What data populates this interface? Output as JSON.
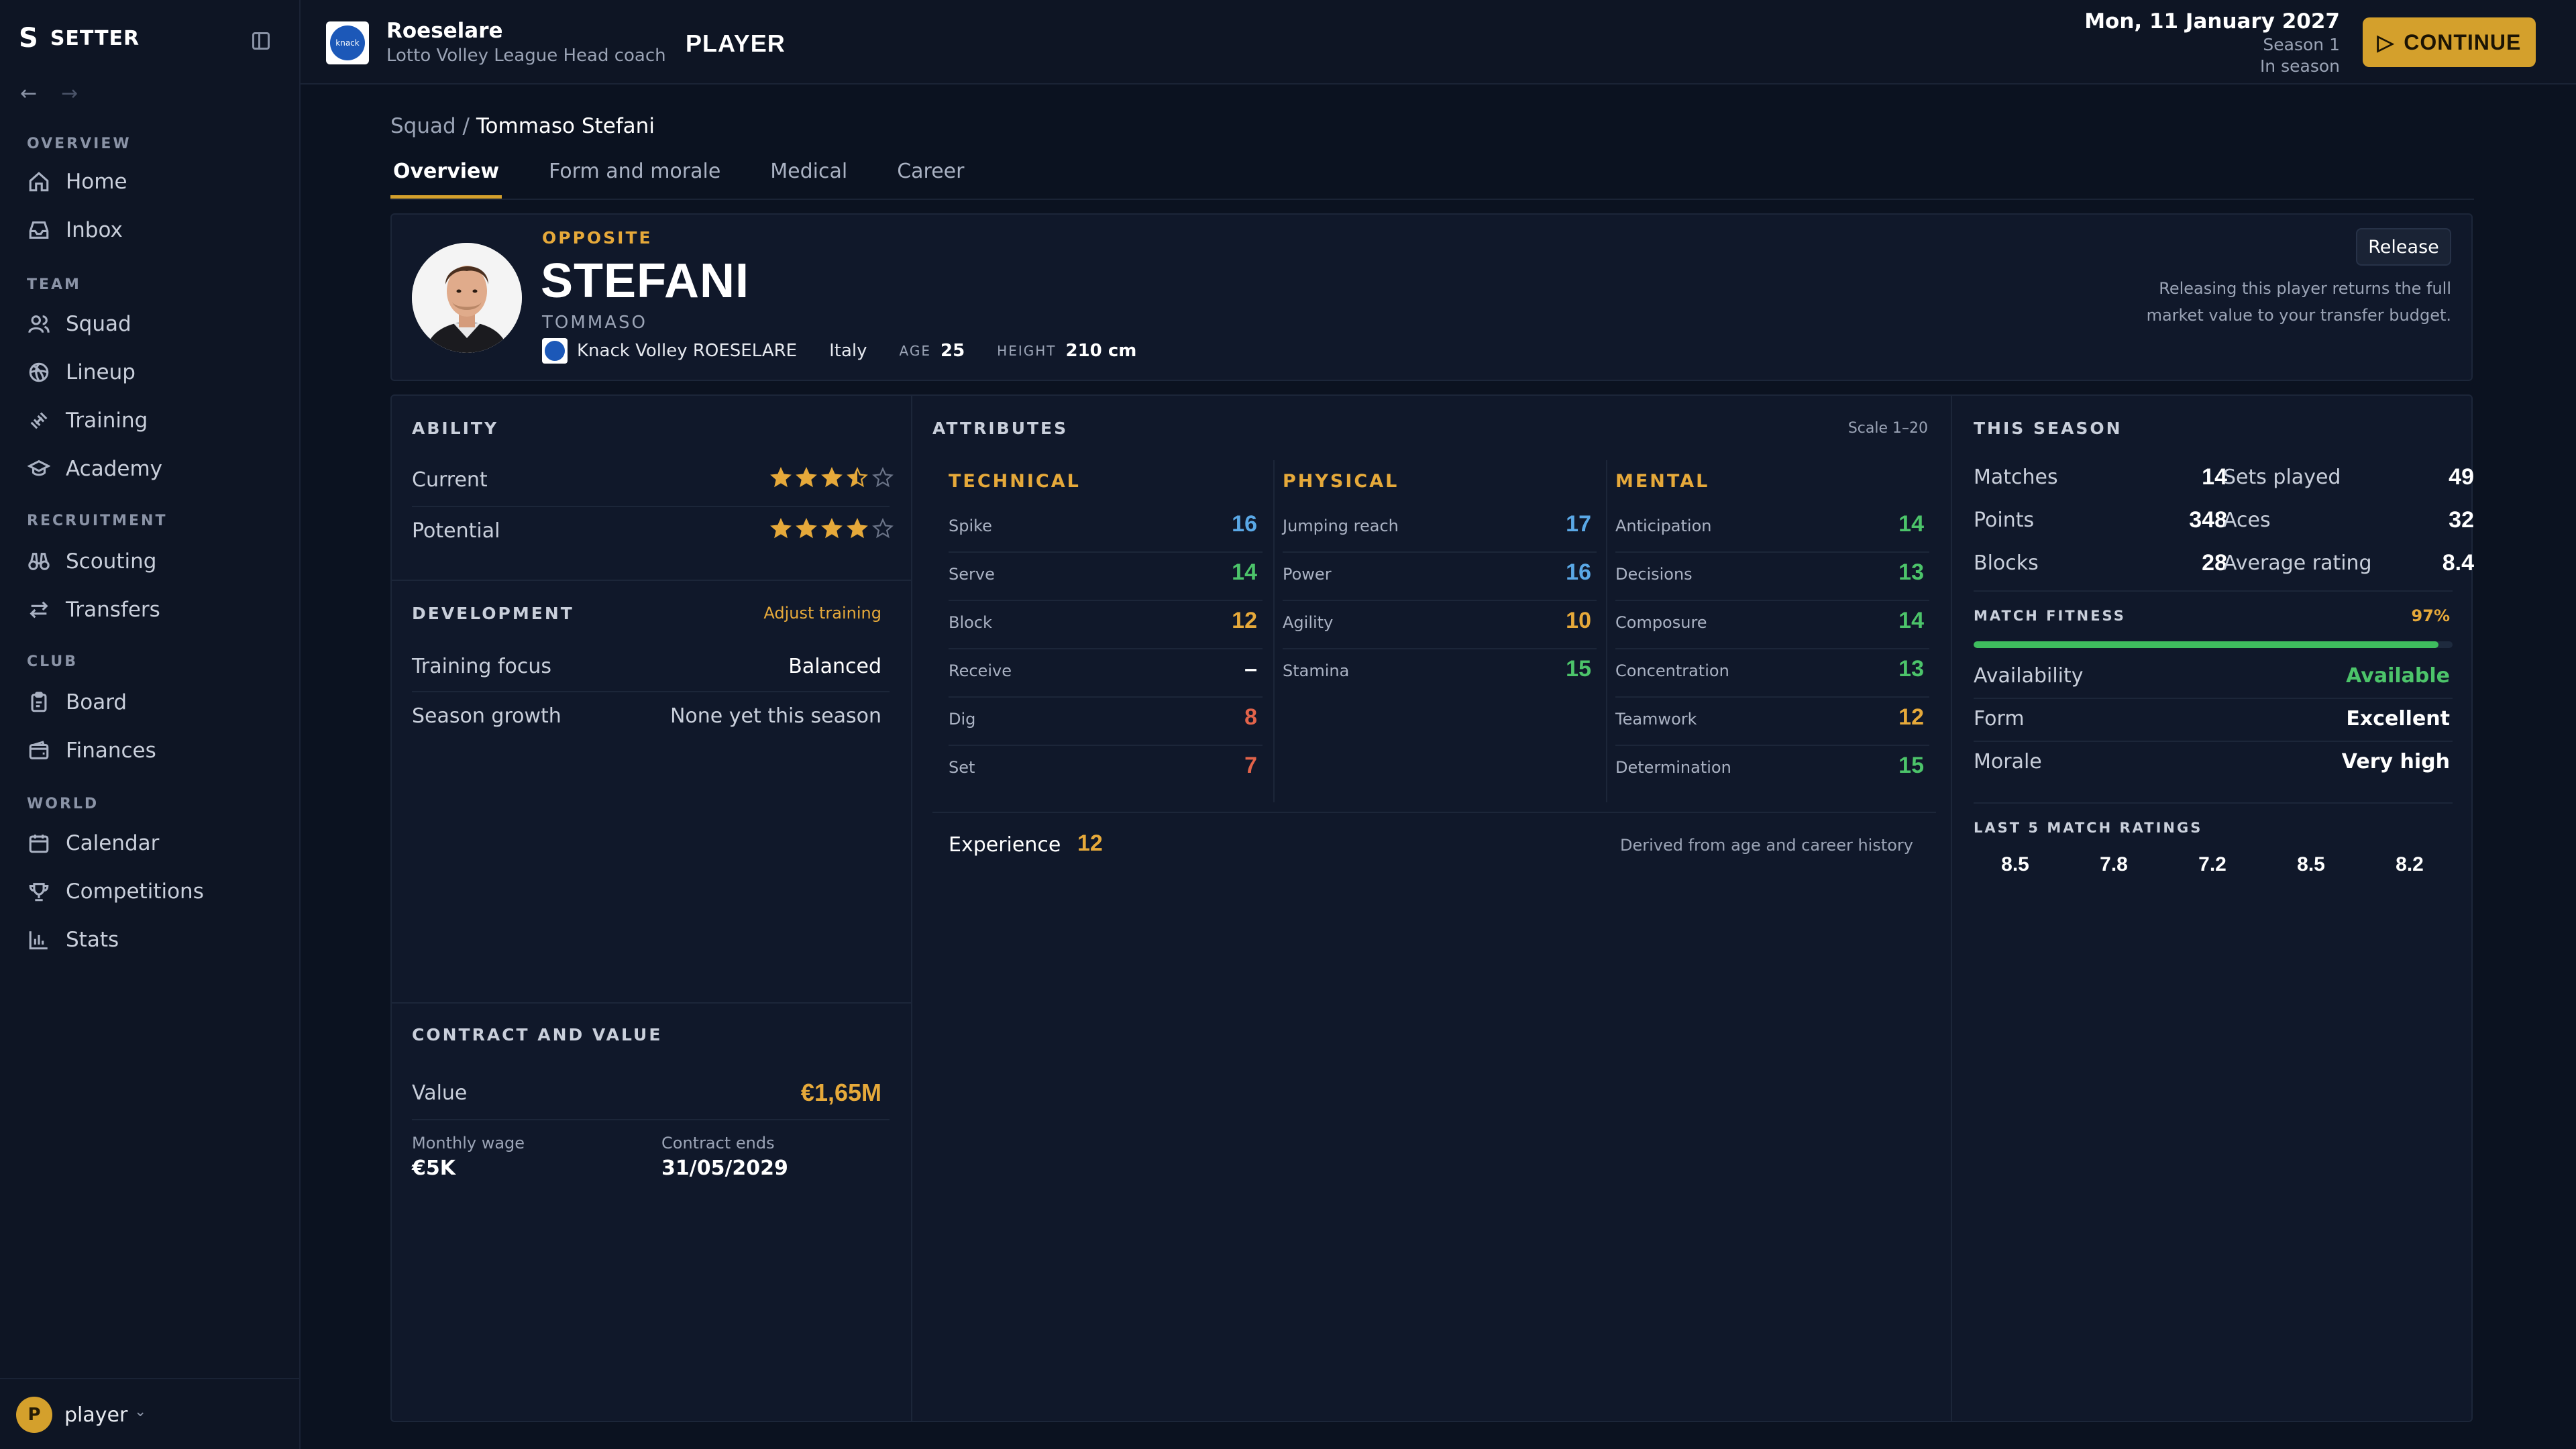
{
  "app": {
    "logo": "S",
    "name": "SETTER"
  },
  "sidebar": {
    "sections": [
      {
        "title": "OVERVIEW",
        "items": [
          {
            "label": "Home",
            "icon": "home-icon"
          },
          {
            "label": "Inbox",
            "icon": "inbox-icon"
          }
        ]
      },
      {
        "title": "TEAM",
        "items": [
          {
            "label": "Squad",
            "icon": "users-icon"
          },
          {
            "label": "Lineup",
            "icon": "volleyball-icon"
          },
          {
            "label": "Training",
            "icon": "dumbbell-icon"
          },
          {
            "label": "Academy",
            "icon": "graduation-cap-icon"
          }
        ]
      },
      {
        "title": "RECRUITMENT",
        "items": [
          {
            "label": "Scouting",
            "icon": "binoculars-icon"
          },
          {
            "label": "Transfers",
            "icon": "swap-arrows-icon"
          }
        ]
      },
      {
        "title": "CLUB",
        "items": [
          {
            "label": "Board",
            "icon": "clipboard-icon"
          },
          {
            "label": "Finances",
            "icon": "wallet-icon"
          }
        ]
      },
      {
        "title": "WORLD",
        "items": [
          {
            "label": "Calendar",
            "icon": "calendar-icon"
          },
          {
            "label": "Competitions",
            "icon": "trophy-icon"
          },
          {
            "label": "Stats",
            "icon": "bar-chart-icon"
          }
        ]
      }
    ],
    "user": {
      "initial": "P",
      "name": "player"
    }
  },
  "header": {
    "club_name": "Roeselare",
    "club_sub": "Lotto Volley League  Head coach",
    "page_kind": "PLAYER",
    "date": "Mon, 11 January 2027",
    "season": "Season 1",
    "phase": "In season",
    "continue_label": "CONTINUE"
  },
  "breadcrumb": {
    "parent": "Squad",
    "sep": "/",
    "current": "Tommaso Stefani"
  },
  "tabs": [
    "Overview",
    "Form and morale",
    "Medical",
    "Career"
  ],
  "player": {
    "position": "OPPOSITE",
    "surname": "STEFANI",
    "firstname": "TOMMASO",
    "club": "Knack Volley ROESELARE",
    "nationality": "Italy",
    "age_label": "AGE",
    "age": "25",
    "height_label": "HEIGHT",
    "height": "210 cm",
    "release_label": "Release",
    "release_note": "Releasing this player returns the full market value to your transfer budget."
  },
  "ability": {
    "title": "ABILITY",
    "current_label": "Current",
    "current_stars": 3.5,
    "potential_label": "Potential",
    "potential_stars": 4,
    "max_stars": 5
  },
  "development": {
    "title": "DEVELOPMENT",
    "link": "Adjust training",
    "focus_label": "Training focus",
    "focus_value": "Balanced",
    "growth_label": "Season growth",
    "growth_value": "None yet this season"
  },
  "contract": {
    "title": "CONTRACT AND VALUE",
    "value_label": "Value",
    "value": "€1,65M",
    "wage_label": "Monthly wage",
    "wage": "€5K",
    "ends_label": "Contract ends",
    "ends": "31/05/2029"
  },
  "attributes": {
    "title": "ATTRIBUTES",
    "scale": "Scale 1–20",
    "groups": [
      {
        "name": "TECHNICAL",
        "items": [
          {
            "name": "Spike",
            "value": "16",
            "color": "#5aa8e6"
          },
          {
            "name": "Serve",
            "value": "14",
            "color": "#4cc46a"
          },
          {
            "name": "Block",
            "value": "12",
            "color": "#e6a93a"
          },
          {
            "name": "Receive",
            "value": "–",
            "color": "#ffffff"
          },
          {
            "name": "Dig",
            "value": "8",
            "color": "#e2634a"
          },
          {
            "name": "Set",
            "value": "7",
            "color": "#e2634a"
          }
        ]
      },
      {
        "name": "PHYSICAL",
        "items": [
          {
            "name": "Jumping reach",
            "value": "17",
            "color": "#5aa8e6"
          },
          {
            "name": "Power",
            "value": "16",
            "color": "#5aa8e6"
          },
          {
            "name": "Agility",
            "value": "10",
            "color": "#e6a93a"
          },
          {
            "name": "Stamina",
            "value": "15",
            "color": "#4cc46a"
          }
        ]
      },
      {
        "name": "MENTAL",
        "items": [
          {
            "name": "Anticipation",
            "value": "14",
            "color": "#4cc46a"
          },
          {
            "name": "Decisions",
            "value": "13",
            "color": "#4cc46a"
          },
          {
            "name": "Composure",
            "value": "14",
            "color": "#4cc46a"
          },
          {
            "name": "Concentration",
            "value": "13",
            "color": "#4cc46a"
          },
          {
            "name": "Teamwork",
            "value": "12",
            "color": "#e6a93a"
          },
          {
            "name": "Determination",
            "value": "15",
            "color": "#4cc46a"
          }
        ]
      }
    ],
    "experience_label": "Experience",
    "experience_value": "12",
    "experience_note": "Derived from age and career history"
  },
  "season": {
    "title": "THIS SEASON",
    "stats": [
      {
        "label": "Matches",
        "value": "14"
      },
      {
        "label": "Sets played",
        "value": "49"
      },
      {
        "label": "Points",
        "value": "348"
      },
      {
        "label": "Aces",
        "value": "32"
      },
      {
        "label": "Blocks",
        "value": "28"
      },
      {
        "label": "Average rating",
        "value": "8.4"
      }
    ],
    "fitness_label": "MATCH FITNESS",
    "fitness_value": "97%",
    "fitness_fraction": 0.97,
    "availability_label": "Availability",
    "availability": "Available",
    "form_label": "Form",
    "form": "Excellent",
    "morale_label": "Morale",
    "morale": "Very high",
    "ratings_title": "LAST 5 MATCH RATINGS",
    "ratings": [
      "8.5",
      "7.8",
      "7.2",
      "8.5",
      "8.2"
    ]
  },
  "colors": {
    "accent": "#d4a02c",
    "available": "#4cc46a",
    "background": "#0b1220"
  }
}
